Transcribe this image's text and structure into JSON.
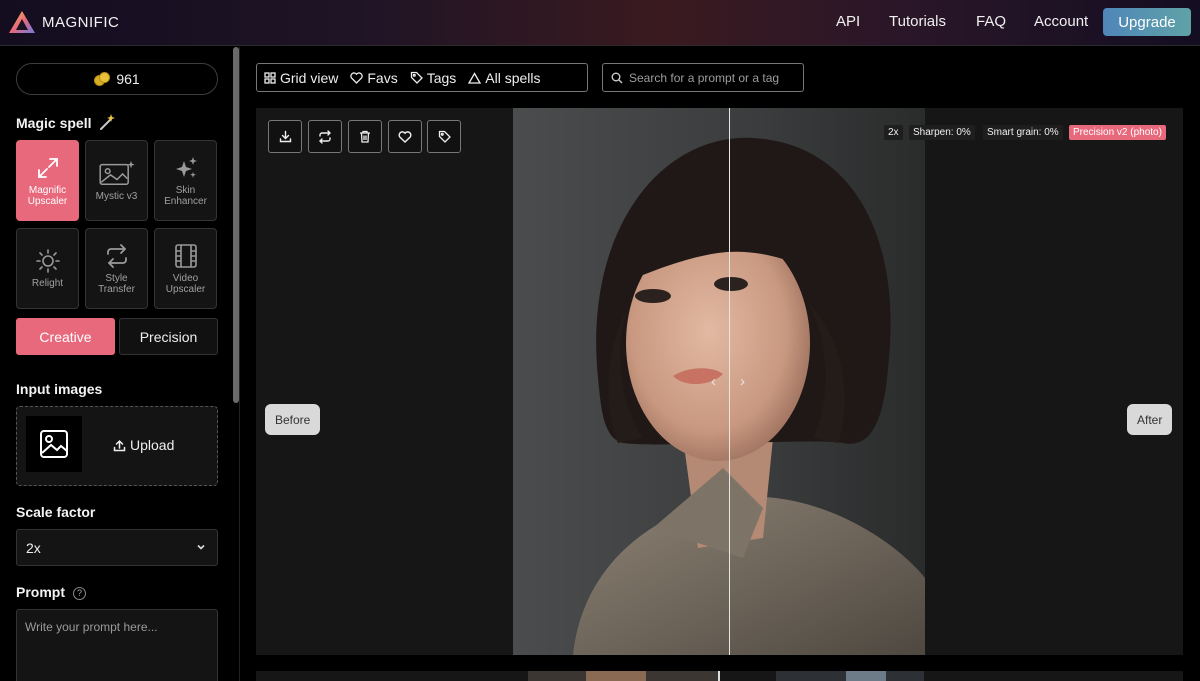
{
  "brand": {
    "name": "MAGNIFIC"
  },
  "nav": {
    "api": "API",
    "tutorials": "Tutorials",
    "faq": "FAQ",
    "account": "Account",
    "upgrade": "Upgrade"
  },
  "sidebar": {
    "credits": "961",
    "magic_spell_title": "Magic spell",
    "spells": [
      {
        "label": "Magnific\nUpscaler",
        "icon": "expand-arrows-icon",
        "active": true
      },
      {
        "label": "Mystic v3",
        "icon": "image-sparkle-icon",
        "active": false
      },
      {
        "label": "Skin\nEnhancer",
        "icon": "sparkles-icon",
        "active": false
      },
      {
        "label": "Relight",
        "icon": "sun-icon",
        "active": false
      },
      {
        "label": "Style\nTransfer",
        "icon": "swap-arrows-icon",
        "active": false
      },
      {
        "label": "Video\nUpscaler",
        "icon": "film-icon",
        "active": false
      }
    ],
    "modes": {
      "creative": "Creative",
      "precision": "Precision",
      "active": "creative"
    },
    "input_images_title": "Input images",
    "upload_label": "Upload",
    "scale_factor_title": "Scale factor",
    "scale_factor_value": "2x",
    "prompt_title": "Prompt",
    "prompt_placeholder": "Write your prompt here..."
  },
  "toolbar": {
    "grid_view": "Grid view",
    "favs": "Favs",
    "tags": "Tags",
    "all_spells": "All spells",
    "search_placeholder": "Search for a prompt or a tag"
  },
  "viewer": {
    "tags": {
      "scale": "2x",
      "sharpen": "Sharpen: 0%",
      "grain": "Smart grain: 0%",
      "engine": "Precision v2 (photo)"
    },
    "before_label": "Before",
    "after_label": "After"
  },
  "colors": {
    "accent": "#e8697c",
    "upgrade_start": "#4f86b9",
    "upgrade_end": "#5fa2a6"
  }
}
